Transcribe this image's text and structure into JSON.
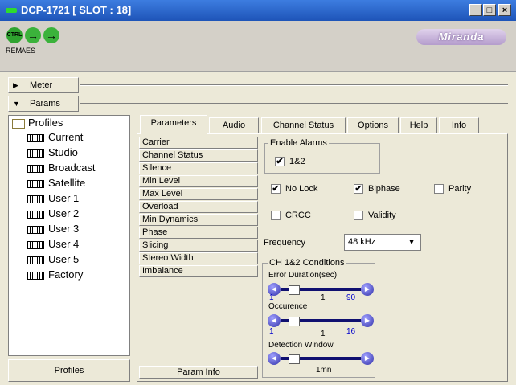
{
  "window": {
    "title": "DCP-1721 [ SLOT : 18]",
    "min": "_",
    "max": "□",
    "close": "×"
  },
  "header": {
    "ctrl_icon": "CTRL",
    "rem": "REM",
    "aes": "AES",
    "logo": "Miranda",
    "arrow": "→"
  },
  "sections": {
    "meter": "Meter",
    "params": "Params"
  },
  "profiles": {
    "root": "Profiles",
    "items": [
      "Current",
      "Studio",
      "Broadcast",
      "Satellite",
      "User 1",
      "User 2",
      "User 3",
      "User 4",
      "User 5",
      "Factory"
    ],
    "button": "Profiles"
  },
  "tabs": [
    "Parameters",
    "Audio",
    "Channel Status",
    "Options",
    "Help",
    "Info"
  ],
  "param_list": [
    "Carrier",
    "Channel Status",
    "Silence",
    "Min Level",
    "Max Level",
    "Overload",
    "Min Dynamics",
    "Phase",
    "Slicing",
    "Stereo Width",
    "Imbalance"
  ],
  "param_info": "Param Info",
  "alarms": {
    "legend": "Enable Alarms",
    "ch12": {
      "label": "1&2",
      "checked": true
    },
    "no_lock": {
      "label": "No Lock",
      "checked": true
    },
    "biphase": {
      "label": "Biphase",
      "checked": true
    },
    "parity": {
      "label": "Parity",
      "checked": false
    },
    "crcc": {
      "label": "CRCC",
      "checked": false
    },
    "validity": {
      "label": "Validity",
      "checked": false
    }
  },
  "frequency": {
    "label": "Frequency",
    "value": "48 kHz"
  },
  "conditions": {
    "legend": "CH 1&2 Conditions",
    "error_duration": {
      "label": "Error Duration(sec)",
      "min": "1",
      "value": "1",
      "max": "90"
    },
    "occurence": {
      "label": "Occurence",
      "min": "1",
      "value": "1",
      "max": "16"
    },
    "detection_window": {
      "label": "Detection Window",
      "value": "1mn"
    }
  },
  "colors": {
    "title_bar": "#1e54b8",
    "led": "#2edb2e",
    "slider": "#101070",
    "link_blue": "#0000cc"
  }
}
